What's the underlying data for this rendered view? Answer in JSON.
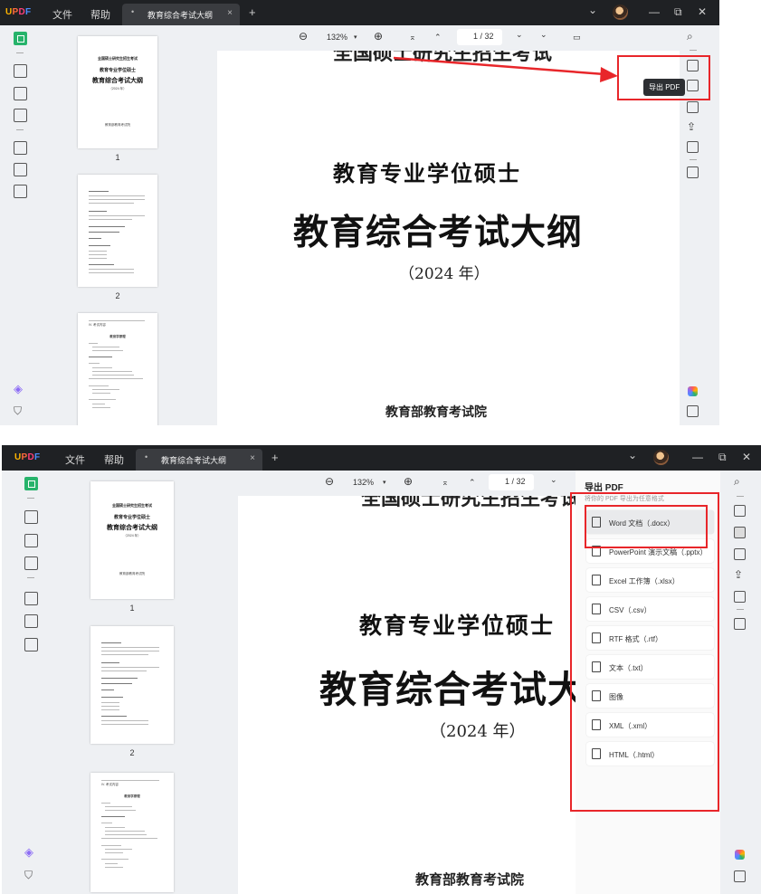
{
  "app": {
    "logo": "UPDF",
    "menu": [
      "文件",
      "帮助"
    ],
    "tab_title": "教育综合考试大纲",
    "tab_dot": "•",
    "tab_close": "×",
    "new_tab": "+",
    "dropdown": "⌄",
    "minimize": "—",
    "restore": "⧉",
    "close": "✕"
  },
  "toolbar": {
    "zoom_out": "⊖",
    "zoom": "132%",
    "zoom_caret": "▾",
    "zoom_in": "⊕",
    "first": "⌅",
    "prev": "⌃",
    "page": "1 / 32",
    "next": "⌄",
    "last": "⌄",
    "present": "▭"
  },
  "thumbnails": [
    {
      "page": "1",
      "line1": "全国硕士研究生招生考试",
      "line2": "教育专业学位硕士",
      "line3": "教育综合考试大纲",
      "line4": "（2024 年）",
      "line5": "教育部教育考试院"
    },
    {
      "page": "2"
    },
    {
      "page": "3",
      "heading": "IV. 考试内容",
      "sub": "教育学原理"
    }
  ],
  "document": {
    "top_cut": "全国硕士研究生招生考试",
    "subtitle": "教育专业学位硕士",
    "title": "教育综合考试大纲",
    "year": "（2024 年）",
    "issuer": "教育部教育考试院"
  },
  "tooltip": "导出 PDF",
  "export_panel": {
    "title": "导出 PDF",
    "note": "将你的 PDF 导出为任意格式",
    "options": [
      {
        "label": "Word 文档（.docx）",
        "icon": "word-icon",
        "selected": true
      },
      {
        "label": "PowerPoint 演示文稿（.pptx）",
        "icon": "powerpoint-icon",
        "selected": false
      },
      {
        "label": "Excel 工作簿（.xlsx）",
        "icon": "excel-icon",
        "selected": false
      },
      {
        "label": "CSV（.csv）",
        "icon": "csv-icon",
        "selected": false
      },
      {
        "label": "RTF 格式（.rtf）",
        "icon": "rtf-icon",
        "selected": false
      },
      {
        "label": "文本（.txt）",
        "icon": "text-icon",
        "selected": false
      },
      {
        "label": "图像",
        "icon": "image-icon",
        "selected": false
      },
      {
        "label": "XML（.xml）",
        "icon": "xml-icon",
        "selected": false
      },
      {
        "label": "HTML（.html）",
        "icon": "html-icon",
        "selected": false
      }
    ]
  },
  "colors": {
    "titlebar": "#1f2124",
    "accent_green": "#27b36b",
    "annotation_red": "#e8262a"
  }
}
